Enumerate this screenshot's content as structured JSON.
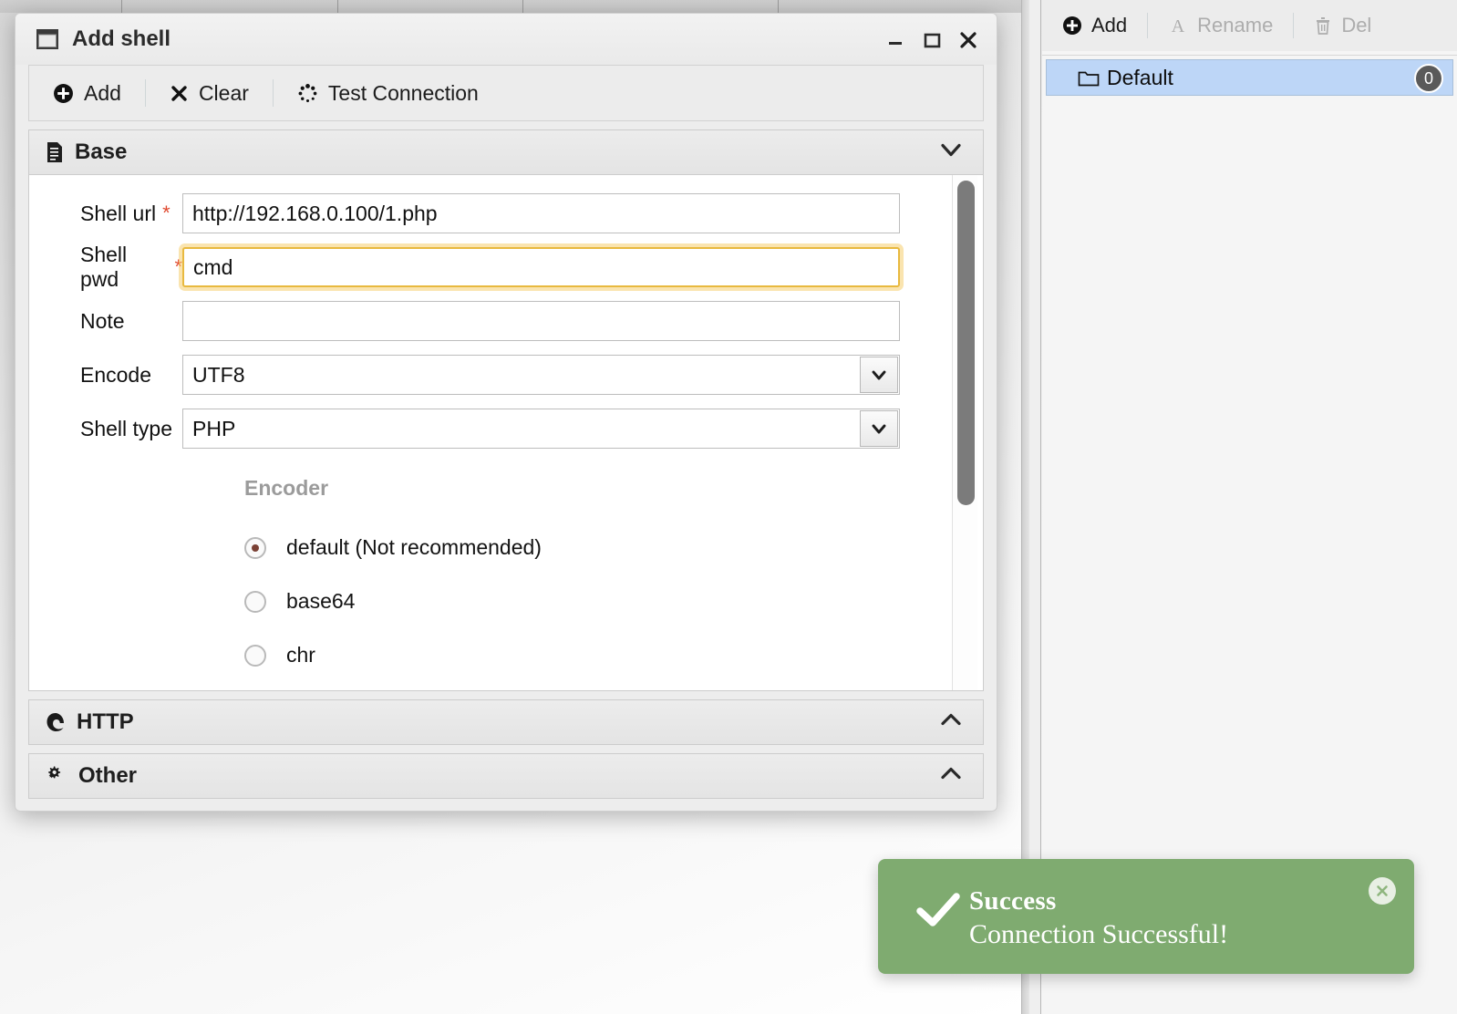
{
  "dialog": {
    "title": "Add shell",
    "title_icon": "window-icon",
    "window_buttons": [
      {
        "name": "minimize",
        "glyph": "–"
      },
      {
        "name": "maximize",
        "glyph": "□"
      },
      {
        "name": "close",
        "glyph": "✕"
      }
    ],
    "toolbar": [
      {
        "label": "Add",
        "icon": "plus-circle-icon"
      },
      {
        "label": "Clear",
        "icon": "cross-icon"
      },
      {
        "label": "Test Connection",
        "icon": "spinner-icon"
      }
    ],
    "sections": [
      {
        "label": "Base",
        "icon": "document-icon",
        "chevron": "down",
        "expanded": true
      },
      {
        "label": "HTTP",
        "icon": "edge-browser-icon",
        "chevron": "up",
        "expanded": false
      },
      {
        "label": "Other",
        "icon": "gears-icon",
        "chevron": "up",
        "expanded": false
      }
    ],
    "form": {
      "fields": [
        {
          "label": "Shell url",
          "required": true,
          "type": "text",
          "value": "http://192.168.0.100/1.php",
          "placeholder": "",
          "focused": false
        },
        {
          "label": "Shell pwd",
          "required": true,
          "type": "text",
          "value": "cmd",
          "placeholder": "",
          "focused": true
        },
        {
          "label": "Note",
          "required": false,
          "type": "text",
          "value": "",
          "placeholder": "",
          "focused": false
        },
        {
          "label": "Encode",
          "required": false,
          "type": "select",
          "value": "UTF8",
          "placeholder": "",
          "focused": false
        },
        {
          "label": "Shell type",
          "required": false,
          "type": "select",
          "value": "PHP",
          "placeholder": "",
          "focused": false
        }
      ],
      "encoder": {
        "group_label": "Encoder",
        "options": [
          {
            "label": "default (Not recommended)",
            "selected": true
          },
          {
            "label": "base64",
            "selected": false
          },
          {
            "label": "chr",
            "selected": false
          }
        ],
        "selected_color": "#7a4034"
      }
    }
  },
  "right_panel": {
    "toolbar": [
      {
        "label": "Add",
        "icon": "plus-circle-icon",
        "disabled": false
      },
      {
        "label": "Rename",
        "icon": "letter-a-icon",
        "disabled": true
      },
      {
        "label": "Del",
        "icon": "trash-icon",
        "disabled": true
      }
    ],
    "folders": [
      {
        "name": "Default",
        "icon": "folder-icon",
        "count": "0",
        "selected": true
      }
    ]
  },
  "toast": {
    "title": "Success",
    "message": "Connection Successful!",
    "icon": "check-icon",
    "close_icon": "close-circle-icon",
    "background_color": "#7fab70"
  }
}
